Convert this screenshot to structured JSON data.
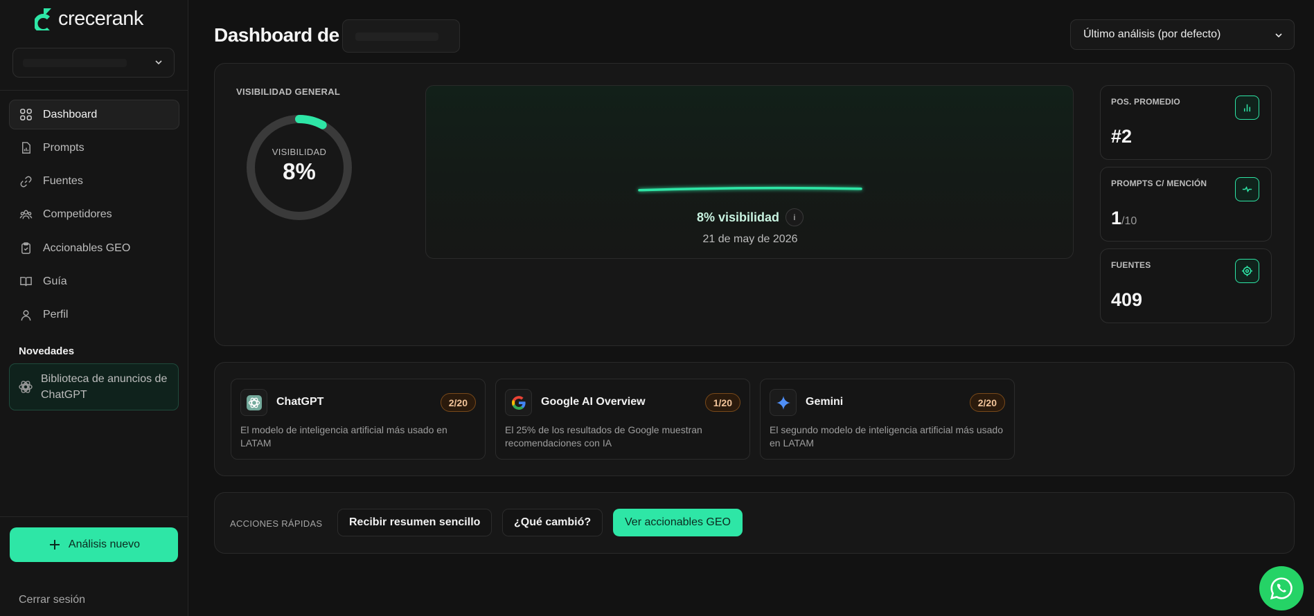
{
  "brand": {
    "name": "crecerank",
    "accent": "#2ee6a6"
  },
  "sidebar": {
    "items": [
      {
        "label": "Dashboard",
        "icon": "grid-icon",
        "active": true
      },
      {
        "label": "Prompts",
        "icon": "document-chart-icon"
      },
      {
        "label": "Fuentes",
        "icon": "link-icon"
      },
      {
        "label": "Competidores",
        "icon": "users-icon"
      },
      {
        "label": "Accionables GEO",
        "icon": "clipboard-check-icon"
      },
      {
        "label": "Guía",
        "icon": "book-icon"
      },
      {
        "label": "Perfil",
        "icon": "user-icon"
      }
    ],
    "news_heading": "Novedades",
    "news_item": "Biblioteca de anuncios de ChatGPT",
    "new_analysis": "Análisis nuevo",
    "logout": "Cerrar sesión"
  },
  "header": {
    "title": "Dashboard de",
    "analysis_select": "Último análisis (por defecto)"
  },
  "visibility": {
    "section_label": "VISIBILIDAD GENERAL",
    "gauge_label": "VISIBILIDAD",
    "gauge_value": "8%",
    "gauge_fraction": 0.08
  },
  "chart_data": {
    "type": "line",
    "x": [
      "21 de may de 2026"
    ],
    "values": [
      8
    ],
    "value_label": "8% visibilidad",
    "info": "i",
    "date_label": "21 de may de 2026"
  },
  "stats": [
    {
      "label": "POS. PROMEDIO",
      "value": "#2",
      "suffix": "",
      "icon": "bar-chart-icon"
    },
    {
      "label": "PROMPTS C/ MENCIÓN",
      "value": "1",
      "suffix": "/10",
      "icon": "activity-icon"
    },
    {
      "label": "FUENTES",
      "value": "409",
      "suffix": "",
      "icon": "target-icon"
    }
  ],
  "models": [
    {
      "name": "ChatGPT",
      "badge": "2/20",
      "desc": "El modelo de inteligencia artificial más usado en LATAM",
      "icon": "openai-icon"
    },
    {
      "name": "Google AI Overview",
      "badge": "1/20",
      "desc": "El 25% de los resultados de Google muestran recomendaciones con IA",
      "icon": "google-icon"
    },
    {
      "name": "Gemini",
      "badge": "2/20",
      "desc": "El segundo modelo de inteligencia artificial más usado en LATAM",
      "icon": "gemini-icon"
    }
  ],
  "quick_actions": {
    "label": "ACCIONES RÁPIDAS",
    "summary": "Recibir resumen sencillo",
    "changes": "¿Qué cambió?",
    "geo": "Ver accionables GEO"
  }
}
